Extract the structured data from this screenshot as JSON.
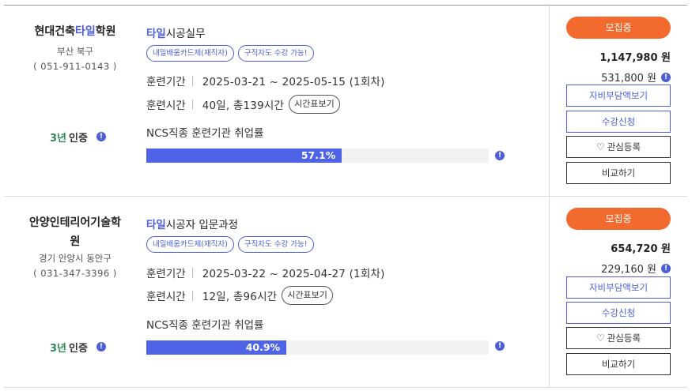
{
  "listings": [
    {
      "institute": {
        "name_pre": "현대건축",
        "name_hl": "타일",
        "name_post": "학원",
        "location": "부산 북구",
        "phone": "( 051-911-0143 )"
      },
      "cert": {
        "years": "3년",
        "label": "인증",
        "info": "!"
      },
      "course": {
        "title_hl": "타일",
        "title_rest": "시공실무"
      },
      "tags": [
        "내일배움카드제(재직자)",
        "구직자도 수강 가능!"
      ],
      "period": {
        "label": "훈련기간",
        "value": "2025-03-21 ~ 2025-05-15 (1회차)"
      },
      "hours": {
        "label": "훈련시간",
        "value": "40일, 총139시간",
        "button": "시간표보기"
      },
      "ncs": {
        "label": "NCS직종 훈련기관 취업률",
        "rate_text": "57.1%",
        "rate": 57.1,
        "info": "!"
      },
      "status": "모집중",
      "price_total": "1,147,980 원",
      "price_self": "531,800 원",
      "price_info": "!",
      "buttons": {
        "self_pay": "자비부담액보기",
        "apply": "수강신청",
        "wishlist": "관심등록",
        "compare": "비교하기"
      }
    },
    {
      "institute": {
        "name_line1": "안양인테리어기술학",
        "name_line2": "원",
        "location": "경기 안양시 동안구",
        "phone": "( 031-347-3396 )"
      },
      "cert": {
        "years": "3년",
        "label": "인증",
        "info": "!"
      },
      "course": {
        "title_hl": "타일",
        "title_rest": "시공자 입문과정"
      },
      "tags": [
        "내일배움카드제(재직자)",
        "구직자도 수강 가능!"
      ],
      "period": {
        "label": "훈련기간",
        "value": "2025-03-22 ~ 2025-04-27 (1회차)"
      },
      "hours": {
        "label": "훈련시간",
        "value": "12일, 총96시간",
        "button": "시간표보기"
      },
      "ncs": {
        "label": "NCS직종 훈련기관 취업률",
        "rate_text": "40.9%",
        "rate": 40.9,
        "info": "!"
      },
      "status": "모집중",
      "price_total": "654,720 원",
      "price_self": "229,160 원",
      "price_info": "!",
      "buttons": {
        "self_pay": "자비부담액보기",
        "apply": "수강신청",
        "wishlist": "관심등록",
        "compare": "비교하기"
      }
    }
  ],
  "icons": {
    "heart": "heart-outline-icon",
    "info": "info-circle-icon"
  },
  "colors": {
    "accent": "#4c5fd6",
    "status": "#f26a2e",
    "bar": "#4f63e7"
  }
}
